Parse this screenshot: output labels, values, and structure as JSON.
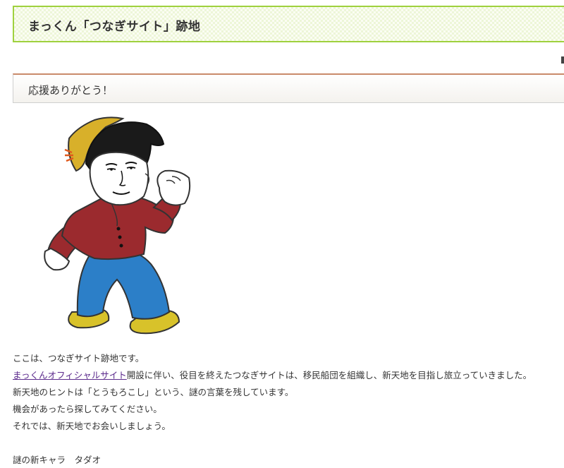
{
  "header": {
    "site_title": "まっくん「つなぎサイト」跡地"
  },
  "section": {
    "title": "応援ありがとう！"
  },
  "mascot": {
    "icon": "mascot-character-illustration",
    "colors": {
      "hat": "#d8b02a",
      "hair": "#1a1a1a",
      "shirt": "#9b2a2e",
      "pants": "#2c7fc8",
      "shoes": "#d8c22a",
      "hat_mark": "#e05a1e"
    }
  },
  "content": {
    "line1": "ここは、つなぎサイト跡地です。",
    "link_text": "まっくんオフィシャルサイト",
    "line2_rest": "開設に伴い、役目を終えたつなぎサイトは、移民船団を組織し、新天地を目指し旅立っていきました。",
    "line3": "新天地のヒントは「とうもろこし」という、謎の言葉を残しています。",
    "line4": "機会があったら探してみてください。",
    "line5": "それでは、新天地でお会いしましょう。",
    "signature": "謎の新キャラ　タダオ"
  },
  "colors": {
    "header_border": "#9fd13e",
    "section_border": "#c98a6a",
    "link": "#5b2a8c"
  }
}
